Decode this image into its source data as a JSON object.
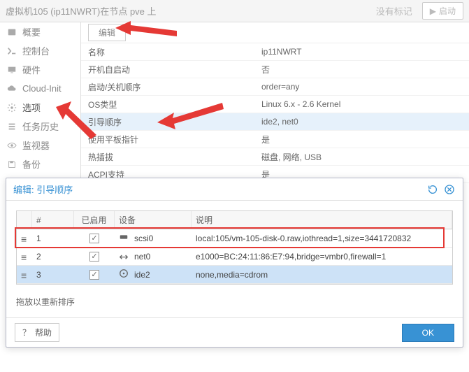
{
  "topbar": {
    "title": "虚拟机105 (ip11NWRT)在节点 pve 上",
    "tag": "没有标记",
    "start_btn": "启动",
    "menu_btn": "⌄"
  },
  "sidebar": {
    "items": [
      {
        "label": "概要"
      },
      {
        "label": "控制台"
      },
      {
        "label": "硬件"
      },
      {
        "label": "Cloud-Init"
      },
      {
        "label": "选项"
      },
      {
        "label": "任务历史"
      },
      {
        "label": "监视器"
      },
      {
        "label": "备份"
      }
    ]
  },
  "toolbar": {
    "edit": "编辑"
  },
  "props": [
    {
      "k": "名称",
      "v": "ip11NWRT"
    },
    {
      "k": "开机自启动",
      "v": "否"
    },
    {
      "k": "启动/关机顺序",
      "v": "order=any"
    },
    {
      "k": "OS类型",
      "v": "Linux 6.x - 2.6 Kernel"
    },
    {
      "k": "引导顺序",
      "v": "ide2, net0"
    },
    {
      "k": "使用平板指针",
      "v": "是"
    },
    {
      "k": "热插拔",
      "v": "磁盘, 网络, USB"
    },
    {
      "k": "ACPI支持",
      "v": "是"
    }
  ],
  "dialog": {
    "title": "编辑: 引导顺序",
    "cols": {
      "num": "#",
      "enabled": "已启用",
      "device": "设备",
      "desc": "说明"
    },
    "rows": [
      {
        "n": "1",
        "enabled": true,
        "dev": "scsi0",
        "desc": "local:105/vm-105-disk-0.raw,iothread=1,size=3441720832",
        "icon": "disk"
      },
      {
        "n": "2",
        "enabled": true,
        "dev": "net0",
        "desc": "e1000=BC:24:11:86:E7:94,bridge=vmbr0,firewall=1",
        "icon": "net"
      },
      {
        "n": "3",
        "enabled": true,
        "dev": "ide2",
        "desc": "none,media=cdrom",
        "icon": "cd"
      }
    ],
    "hint": "拖放以重新排序",
    "help": "帮助",
    "ok": "OK"
  }
}
